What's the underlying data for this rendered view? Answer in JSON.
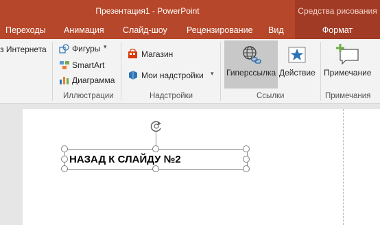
{
  "window": {
    "title": "Презентация1 - PowerPoint",
    "context_header": "Средства рисования"
  },
  "tabs": [
    "Переходы",
    "Анимация",
    "Слайд-шоу",
    "Рецензирование",
    "Вид"
  ],
  "context_tab": "Формат",
  "ribbon": {
    "partial_item": "з Интернета",
    "illustrations": {
      "shapes": "Фигуры",
      "smartart": "SmartArt",
      "chart": "Диаграмма",
      "group_label": "Иллюстрации"
    },
    "addins": {
      "store": "Магазин",
      "my_addins": "Мои надстройки",
      "group_label": "Надстройки"
    },
    "links": {
      "hyperlink": "Гиперссылка",
      "action": "Действие",
      "group_label": "Ссылки"
    },
    "comments": {
      "comment": "Примечание",
      "group_label": "Примечания"
    }
  },
  "slide": {
    "textbox_text": "НАЗАД К СЛАЙДУ №2"
  },
  "colors": {
    "accent": "#b7472a",
    "context_accent": "#a23b25",
    "selected_button": "#c8c8c8"
  }
}
